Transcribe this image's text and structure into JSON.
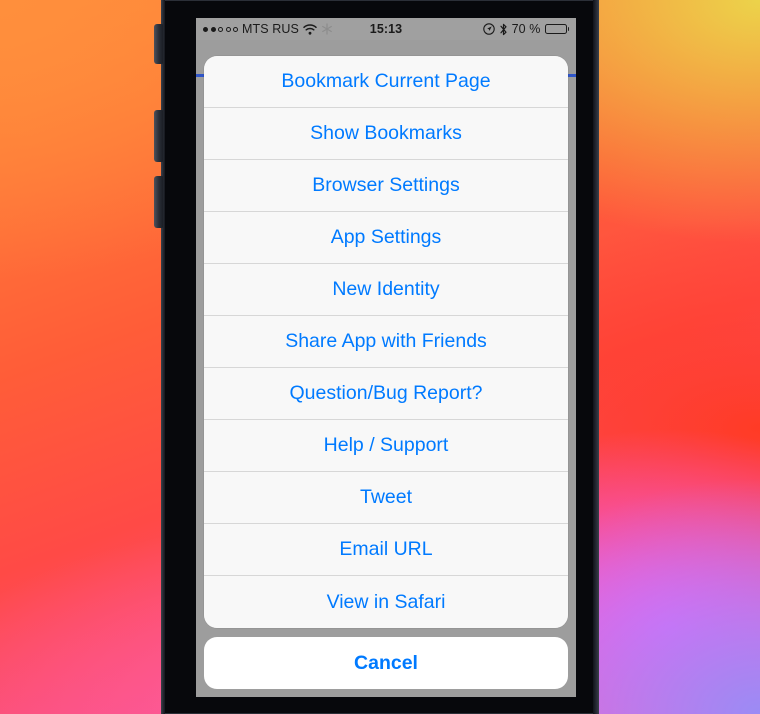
{
  "theme": {
    "accent": "#007AFF",
    "sheet_row_bg": "#F8F8F8",
    "cancel_bg": "#FFFFFF",
    "dimmed_backdrop": "#9D9D9D",
    "statusbar_bg": "#A0A0A0",
    "progress_bar": "#2F55C8",
    "separator": "#D7D7D7",
    "phone_body": "#07080C",
    "wallpaper_stops": [
      "#FF8C3A",
      "#ECD34A",
      "#FF5D38",
      "#FF3B25",
      "#FA4F86",
      "#F25EF8",
      "#9B8BF5"
    ]
  },
  "statusbar": {
    "signal_dots_total": 5,
    "signal_dots_filled": 2,
    "carrier": "MTS RUS",
    "wifi_icon": "wifi-icon",
    "snowflake_icon": "snowflake-icon",
    "time": "15:13",
    "location_icon": "location-arrow-icon",
    "bluetooth_icon": "bluetooth-icon",
    "battery_percent": "70 %",
    "battery_level": 70,
    "battery_icon": "battery-icon"
  },
  "action_sheet": {
    "items": [
      {
        "label": "Bookmark Current Page",
        "name": "bookmark-current-page"
      },
      {
        "label": "Show Bookmarks",
        "name": "show-bookmarks"
      },
      {
        "label": "Browser Settings",
        "name": "browser-settings"
      },
      {
        "label": "App Settings",
        "name": "app-settings"
      },
      {
        "label": "New Identity",
        "name": "new-identity"
      },
      {
        "label": "Share App with Friends",
        "name": "share-app-with-friends"
      },
      {
        "label": "Question/Bug Report?",
        "name": "question-bug-report"
      },
      {
        "label": "Help / Support",
        "name": "help-support"
      },
      {
        "label": "Tweet",
        "name": "tweet"
      },
      {
        "label": "Email URL",
        "name": "email-url"
      },
      {
        "label": "View in Safari",
        "name": "view-in-safari"
      }
    ],
    "cancel_label": "Cancel"
  },
  "device": {
    "buttons": [
      "silent-switch",
      "volume-up-button",
      "volume-down-button"
    ]
  }
}
